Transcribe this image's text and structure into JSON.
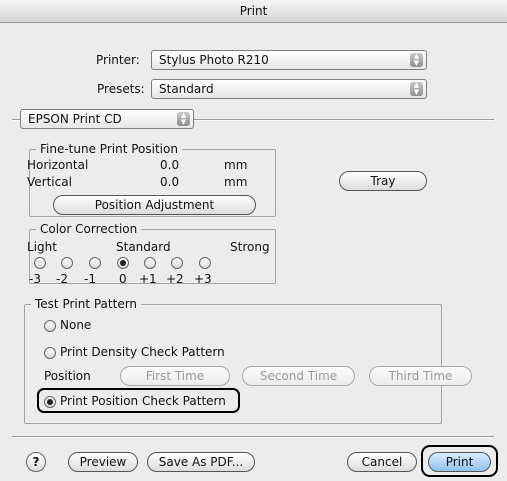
{
  "window": {
    "title": "Print"
  },
  "printer": {
    "label": "Printer:",
    "value": "Stylus Photo R210"
  },
  "presets": {
    "label": "Presets:",
    "value": "Standard"
  },
  "panel": {
    "value": "EPSON Print CD"
  },
  "fine_tune": {
    "title": "Fine-tune Print Position",
    "horizontal": {
      "label": "Horizontal",
      "value": "0.0",
      "unit": "mm"
    },
    "vertical": {
      "label": "Vertical",
      "value": "0.0",
      "unit": "mm"
    },
    "position_adjustment": "Position Adjustment",
    "tray": "Tray"
  },
  "color_correction": {
    "title": "Color Correction",
    "light": "Light",
    "standard": "Standard",
    "strong": "Strong",
    "levels": [
      "-3",
      "-2",
      "-1",
      "0",
      "+1",
      "+2",
      "+3"
    ],
    "selected": "0"
  },
  "test_print": {
    "title": "Test Print Pattern",
    "none": "None",
    "density": "Print Density Check Pattern",
    "position_label": "Position",
    "first": "First Time",
    "second": "Second Time",
    "third": "Third Time",
    "position_check": "Print Position Check Pattern",
    "selected": "Print Position Check Pattern"
  },
  "footer": {
    "help": "?",
    "preview": "Preview",
    "save_pdf": "Save As PDF...",
    "cancel": "Cancel",
    "print": "Print"
  }
}
